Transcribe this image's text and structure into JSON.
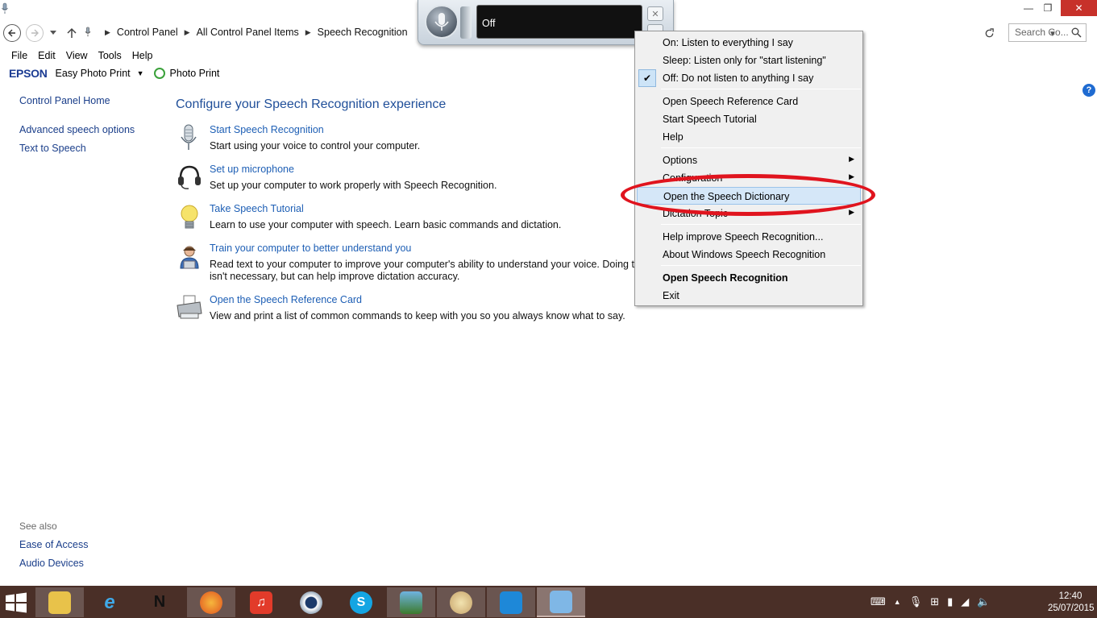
{
  "window": {
    "min_glyph": "—",
    "restore_glyph": "❐",
    "close_glyph": "✕"
  },
  "address": {
    "crumbs": [
      "Control Panel",
      "All Control Panel Items",
      "Speech Recognition"
    ],
    "search_placeholder": "Search Co..."
  },
  "menubar": [
    "File",
    "Edit",
    "View",
    "Tools",
    "Help"
  ],
  "epson": {
    "logo": "EPSON",
    "easy_photo": "Easy Photo Print",
    "photo_print": "Photo Print"
  },
  "leftpane": {
    "home": "Control Panel Home",
    "advanced": "Advanced speech options",
    "tts": "Text to Speech",
    "see_also": "See also",
    "ease": "Ease of Access",
    "audio": "Audio Devices"
  },
  "main": {
    "title": "Configure your Speech Recognition experience",
    "tasks": [
      {
        "link": "Start Speech Recognition",
        "desc": "Start using your voice to control your computer.",
        "icon": "microphone-icon"
      },
      {
        "link": "Set up microphone",
        "desc": "Set up your computer to work properly with Speech Recognition.",
        "icon": "headset-icon"
      },
      {
        "link": "Take Speech Tutorial",
        "desc": "Learn to use your computer with speech.  Learn basic commands and dictation.",
        "icon": "lightbulb-icon"
      },
      {
        "link": "Train your computer to better understand you",
        "desc": "Read text to your computer to improve your computer's ability to understand your voice.  Doing this isn't necessary, but can help improve dictation accuracy.",
        "icon": "person-icon"
      },
      {
        "link": "Open the Speech Reference Card",
        "desc": "View and print a list of common commands to keep with you so you always know what to say.",
        "icon": "printer-icon"
      }
    ]
  },
  "srbar": {
    "status": "Off"
  },
  "context_menu": {
    "items": [
      {
        "label": "On: Listen to everything I say"
      },
      {
        "label": "Sleep: Listen only for \"start listening\""
      },
      {
        "label": "Off: Do not listen to anything I say",
        "checked": true
      },
      {
        "label": "Open Speech Reference Card"
      },
      {
        "label": "Start Speech Tutorial"
      },
      {
        "label": "Help"
      },
      {
        "label": "Options",
        "submenu": true
      },
      {
        "label": "Configuration",
        "submenu": true
      },
      {
        "label": "Open the Speech Dictionary",
        "highlight": true
      },
      {
        "label": "Dictation Topic",
        "submenu": true
      },
      {
        "label": "Help improve Speech Recognition..."
      },
      {
        "label": "About Windows Speech Recognition"
      },
      {
        "label": "Open Speech Recognition",
        "bold": true
      },
      {
        "label": "Exit"
      }
    ]
  },
  "taskbar": {
    "time": "12:40",
    "date": "25/07/2015",
    "accent": "#4a2f27"
  }
}
